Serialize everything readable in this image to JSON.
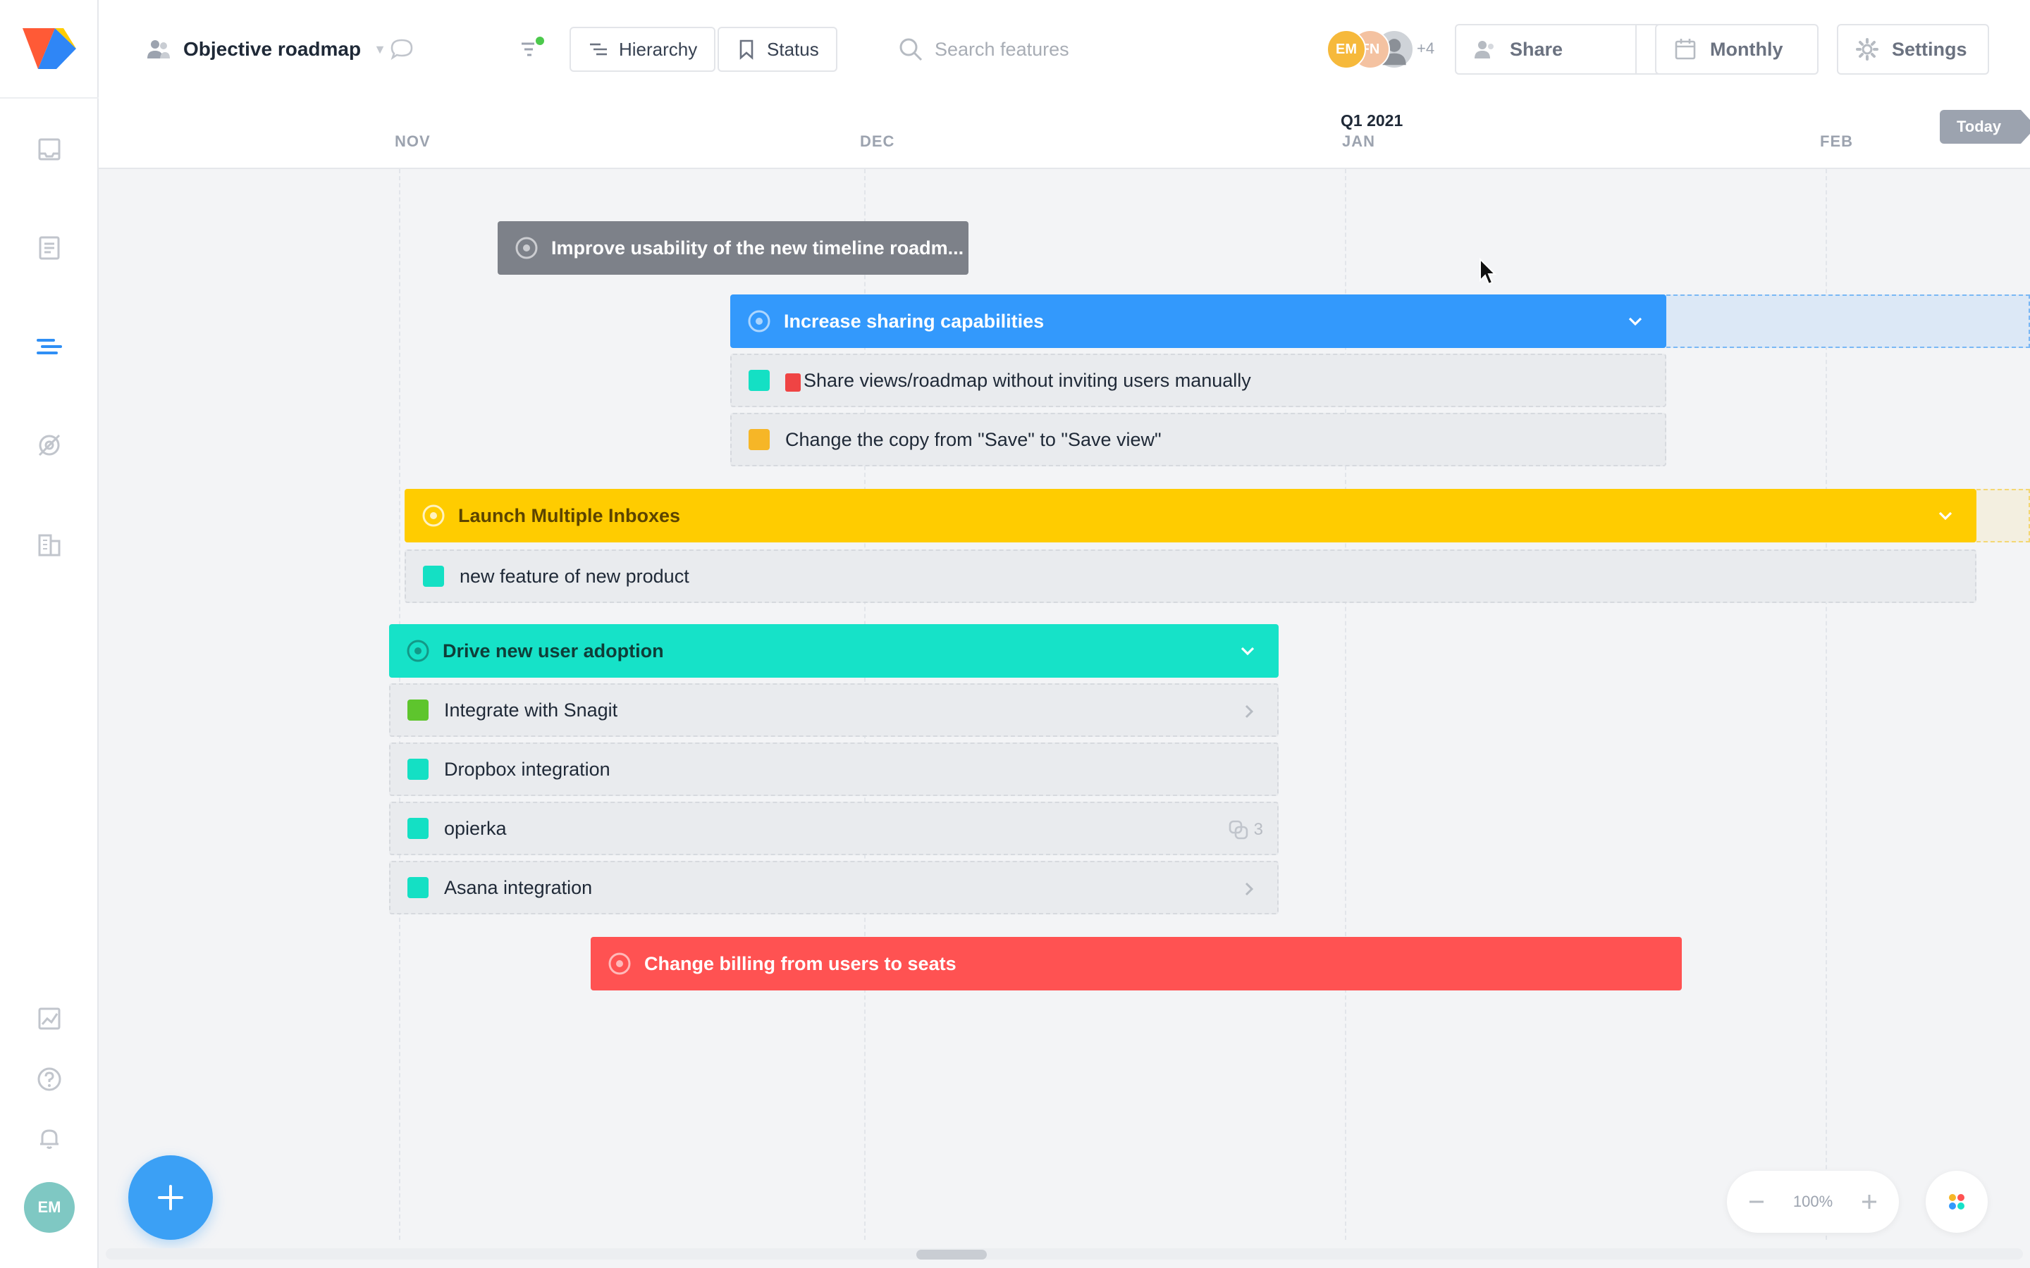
{
  "header": {
    "title": "Objective roadmap",
    "hierarchy_label": "Hierarchy",
    "status_label": "Status",
    "search_placeholder": "Search features",
    "share_label": "Share",
    "view_label": "Monthly",
    "settings_label": "Settings",
    "users": [
      {
        "initials": "EM",
        "color": "#f6b93b"
      },
      {
        "initials": "FN",
        "color": "#f4c2a1"
      },
      {
        "initials": "",
        "color": "#cfd3d8"
      }
    ],
    "more_users": "+4"
  },
  "timeline": {
    "quarter": "Q1 2021",
    "months": [
      "NOV",
      "DEC",
      "JAN",
      "FEB"
    ],
    "today_label": "Today"
  },
  "objectives": [
    {
      "title": "Improve usability of the new timeline roadm...",
      "color": "#7d8189"
    },
    {
      "title": "Increase sharing capabilities",
      "color": "#3399fc",
      "features": [
        {
          "title": "Share views/roadmap without inviting users manually",
          "color": "#14e0c4",
          "flag": true
        },
        {
          "title": "Change the copy from \"Save\" to \"Save view\"",
          "color": "#f6b627"
        }
      ]
    },
    {
      "title": "Launch Multiple Inboxes",
      "color": "#ffcc00",
      "text_color": "#5c4400",
      "features": [
        {
          "title": "new feature of new product",
          "color": "#14e0c4"
        }
      ]
    },
    {
      "title": "Drive new user adoption",
      "color": "#16e2c8",
      "text_color": "#0f3d38",
      "features": [
        {
          "title": "Integrate with Snagit",
          "color": "#5ec52d"
        },
        {
          "title": "Dropbox integration",
          "color": "#14e0c4"
        },
        {
          "title": "opierka",
          "color": "#14e0c4",
          "links": "3"
        },
        {
          "title": "Asana integration",
          "color": "#14e0c4"
        }
      ]
    },
    {
      "title": "Change billing from users to seats",
      "color": "#ff5252"
    }
  ],
  "bottom": {
    "zoom_level": "100%",
    "user_initials": "EM"
  }
}
